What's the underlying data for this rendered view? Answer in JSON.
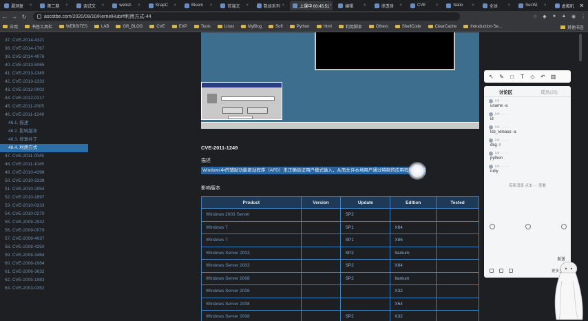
{
  "browser": {
    "tabs": [
      {
        "title": "漏洞复"
      },
      {
        "title": "第二期"
      },
      {
        "title": "调试文"
      },
      {
        "title": "websh"
      },
      {
        "title": "SnapC"
      },
      {
        "title": "Bluem"
      },
      {
        "title": "前端文"
      },
      {
        "title": "数组系列"
      },
      {
        "title": "上课中 00:45:51"
      },
      {
        "title": "编辑"
      },
      {
        "title": "渗透测"
      },
      {
        "title": "CVE"
      },
      {
        "title": "Natio"
      },
      {
        "title": "全球"
      },
      {
        "title": "SecWi"
      },
      {
        "title": "虚拟机"
      }
    ],
    "active_tab": "上课中 00:45:51",
    "url": "ascotbe.com/2020/08/10/KernelHub/#利用方式-44",
    "bookmarks": [
      "应用",
      "书签工具栏",
      "WEBSITES",
      "LAB",
      "GR_BLOG",
      "CVE",
      "EXP",
      "Tools",
      "Linux",
      "MyBlog",
      "Soft",
      "Python",
      "Html",
      "利用脚本",
      "Others",
      "ShellCode",
      "ClearCache",
      "Introduction·Se..."
    ],
    "bookmarks_right": "其他书签"
  },
  "toc": {
    "items": [
      {
        "label": "37. CVE-2014-4321",
        "sub": false
      },
      {
        "label": "38. CVE-2014-1767",
        "sub": false
      },
      {
        "label": "39. CVE-2014-4076",
        "sub": false
      },
      {
        "label": "40. CVE-2013-5065",
        "sub": false
      },
      {
        "label": "41. CVE-2013-1345",
        "sub": false
      },
      {
        "label": "42. CVE-2013-1332",
        "sub": false
      },
      {
        "label": "43. CVE-2012-0002",
        "sub": false
      },
      {
        "label": "44. CVE-2012-0217",
        "sub": false
      },
      {
        "label": "45. CVE-2011-2005",
        "sub": false
      },
      {
        "label": "46. CVE-2011-1249",
        "sub": false
      },
      {
        "label": "46.1. 描述",
        "sub": true
      },
      {
        "label": "46.2. 影响版本",
        "sub": true
      },
      {
        "label": "46.3. 修复补丁",
        "sub": true
      },
      {
        "label": "46.4. 利用方式",
        "sub": true,
        "active": true
      },
      {
        "label": "47. CVE-2011-0045",
        "sub": false
      },
      {
        "label": "48. CVE-2011-1045",
        "sub": false
      },
      {
        "label": "49. CVE-2010-4398",
        "sub": false
      },
      {
        "label": "50. CVE-2010-3338",
        "sub": false
      },
      {
        "label": "51. CVE-2010-2554",
        "sub": false
      },
      {
        "label": "52. CVE-2010-1897",
        "sub": false
      },
      {
        "label": "53. CVE-2010-0233",
        "sub": false
      },
      {
        "label": "54. CVE-2010-0270",
        "sub": false
      },
      {
        "label": "55. CVE-2009-2532",
        "sub": false
      },
      {
        "label": "56. CVE-2009-0079",
        "sub": false
      },
      {
        "label": "57. CVE-2008-4037",
        "sub": false
      },
      {
        "label": "58. CVE-2008-4250",
        "sub": false
      },
      {
        "label": "59. CVE-2008-3464",
        "sub": false
      },
      {
        "label": "60. CVE-2008-1084",
        "sub": false
      },
      {
        "label": "61. CVE-2006-3632",
        "sub": false
      },
      {
        "label": "62. CVE-2005-1983",
        "sub": false
      },
      {
        "label": "63. CVE-2003-0352",
        "sub": false
      }
    ]
  },
  "article": {
    "heading": "CVE-2011-1249",
    "desc_heading": "描述",
    "desc_text": "Windows中的辅助功能驱动程序（AFD）未正确验证用户模式输入，从而允许本地用户通过特制的应用程序获得特权（又名\"辅助功能驱动程序中的提权漏洞\"）",
    "affected_heading": "影响版本",
    "table": {
      "columns": [
        "Product",
        "Version",
        "Update",
        "Edition",
        "Tested"
      ],
      "rows": [
        [
          "Windows 2003 Server",
          "",
          "SP2",
          "",
          ""
        ],
        [
          "Windows 7",
          "",
          "SP1",
          "X64",
          ""
        ],
        [
          "Windows 7",
          "",
          "SP1",
          "X86",
          ""
        ],
        [
          "Windows Server 2003",
          "",
          "SP2",
          "Itanium",
          ""
        ],
        [
          "Windows Server 2003",
          "",
          "SP2",
          "X64",
          ""
        ],
        [
          "Windows Server 2008",
          "",
          "SP2",
          "Itanium",
          ""
        ],
        [
          "Windows Server 2008",
          "",
          "",
          "X32",
          ""
        ],
        [
          "Windows Server 2008",
          "",
          "",
          "X64",
          ""
        ],
        [
          "Windows Server 2008",
          "",
          "SP2",
          "X32",
          ""
        ]
      ]
    }
  },
  "chat": {
    "tabs": [
      "讨论区",
      "成员(25)"
    ],
    "messages": [
      {
        "user": "k4l ··· ···",
        "text": "uname -a"
      },
      {
        "user": "k4l ··· ···",
        "text": "id"
      },
      {
        "user": "k4l ··· ···",
        "text": "lsb_release -a"
      },
      {
        "user": "k4l ··· ···",
        "text": "dkg -l"
      },
      {
        "user": "k4l ··· ···",
        "text": "python"
      },
      {
        "user": "k4l ··· ···",
        "text": "ruby"
      }
    ],
    "more_text": "有新消息 点击 ··· 查看",
    "send_label": "发送",
    "bottom_label": "更多互动"
  },
  "colors": {
    "toc_link": "#6e8fb0",
    "toc_active_bg": "#2f6ea5",
    "table_border": "#3f82c2",
    "highlight": "#2a65a0"
  }
}
